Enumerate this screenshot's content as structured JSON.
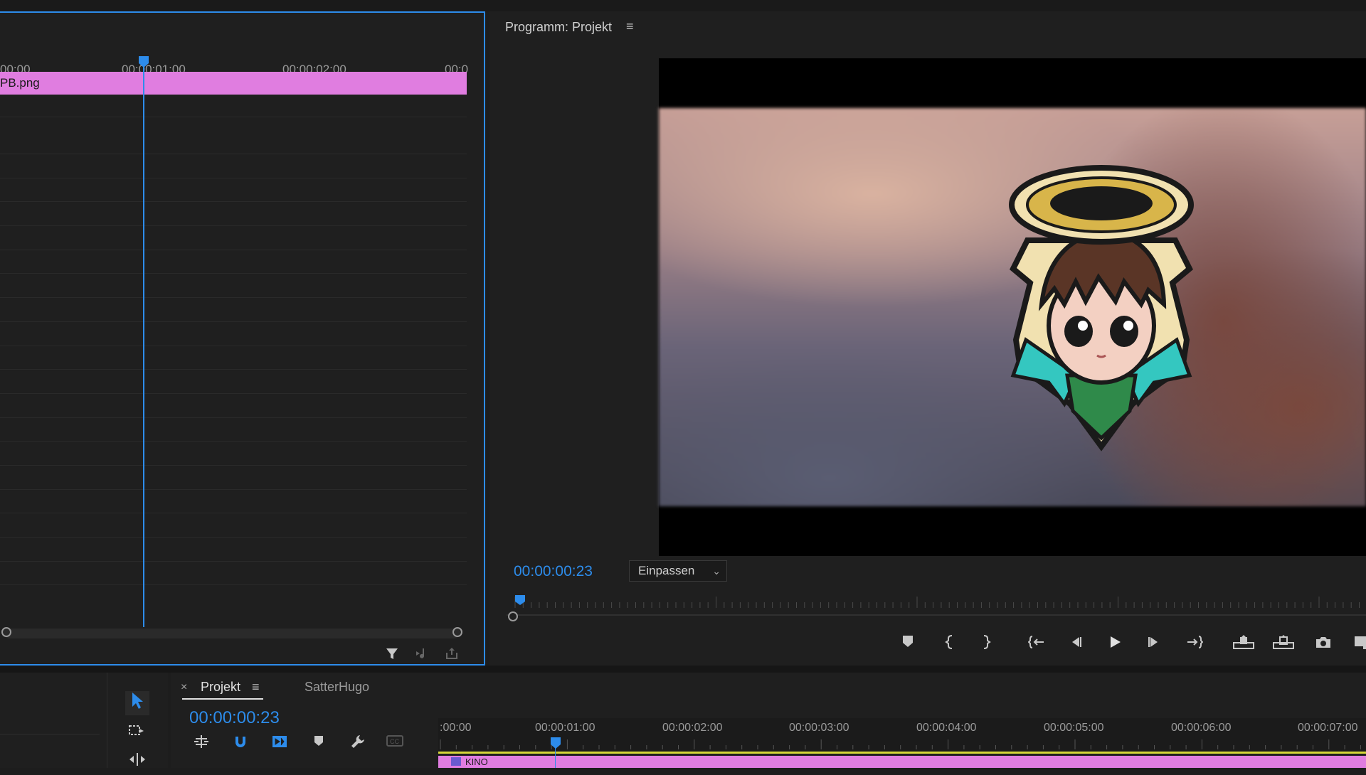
{
  "effect_controls": {
    "ruler_labels": [
      "00:00",
      "00:00:01:00",
      "00:00:02:00",
      "00:0"
    ],
    "clip_name": "PB.png"
  },
  "program_monitor": {
    "title": "Programm: Projekt",
    "timecode": "00:00:00:23",
    "zoom": "Einpassen",
    "playhead_fraction": 0.02
  },
  "sequence": {
    "tabs": [
      {
        "label": "Projekt",
        "active": true
      },
      {
        "label": "SatterHugo",
        "active": false
      }
    ],
    "timecode": "00:00:00:23",
    "ruler_labels": [
      ":00:00",
      "00:00:01:00",
      "00:00:02:00",
      "00:00:03:00",
      "00:00:04:00",
      "00:00:05:00",
      "00:00:06:00",
      "00:00:07:00"
    ],
    "clip_name": "KINO"
  },
  "colors": {
    "accent": "#2d8ceb",
    "clip": "#e07de0",
    "in_out_bar": "#d6d63a"
  },
  "icons": {
    "panel_menu": "hamburger-icon",
    "tab_close": "close-icon"
  }
}
